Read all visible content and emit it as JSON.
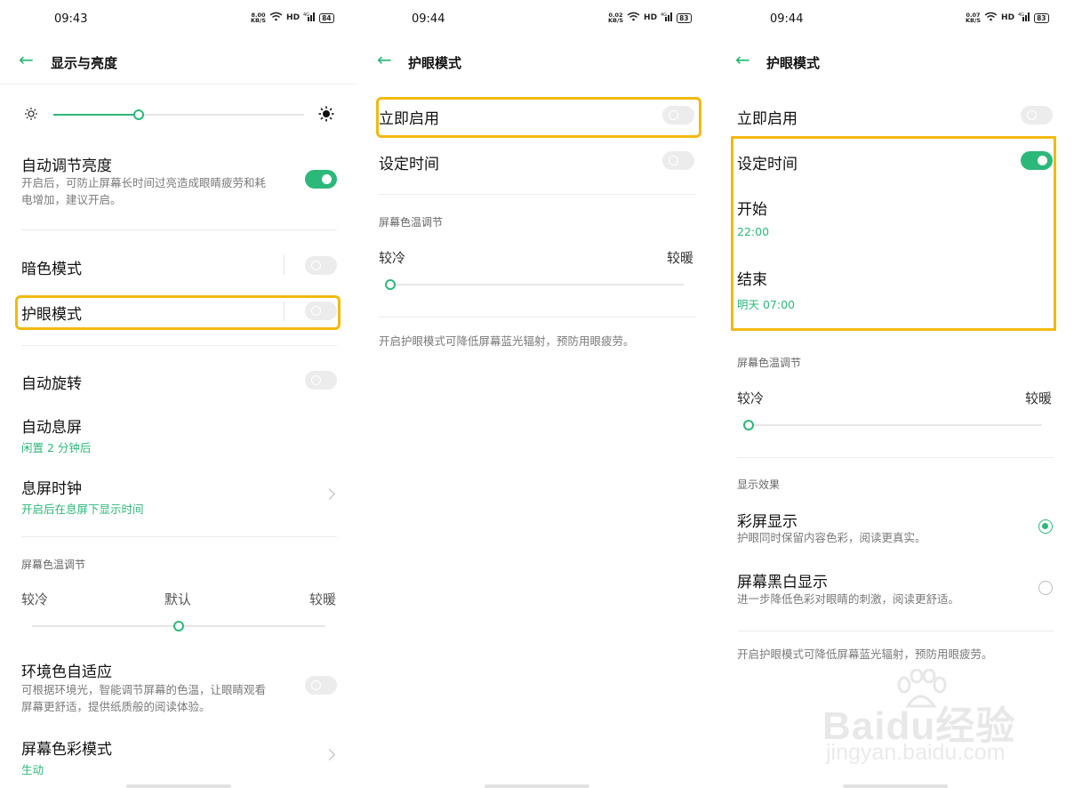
{
  "panel1": {
    "status": {
      "time": "09:43",
      "net_top": "8.00",
      "net_bottom": "KB/S",
      "hd": "HD",
      "sig": "4G",
      "battery": "84"
    },
    "title": "显示与亮度",
    "brightness": {
      "level": 0.34
    },
    "auto_brightness": {
      "label": "自动调节亮度",
      "desc_line1": "开启后，可防止屏幕长时间过亮造成眼睛疲劳和耗",
      "desc_line2": "电增加，建议开启。",
      "on": true
    },
    "dark_mode": {
      "label": "暗色模式",
      "on": false
    },
    "eye_mode": {
      "label": "护眼模式",
      "on": false
    },
    "auto_rotate": {
      "label": "自动旋转",
      "on": false
    },
    "auto_sleep": {
      "label": "自动息屏",
      "value": "闲置 2 分钟后"
    },
    "sleep_clock": {
      "label": "息屏时钟",
      "value": "开启后在息屏下显示时间"
    },
    "color_temp": {
      "section": "屏幕色温调节",
      "cool": "较冷",
      "default": "默认",
      "warm": "较暖",
      "level": 0.5
    },
    "ambient": {
      "label": "环境色自适应",
      "desc_line1": "可根据环境光，智能调节屏幕的色温，让眼睛观看",
      "desc_line2": "屏幕更舒适，提供纸质般的阅读体验。",
      "on": false
    },
    "color_mode": {
      "label": "屏幕色彩模式",
      "value": "生动"
    }
  },
  "panel2": {
    "status": {
      "time": "09:44",
      "net_top": "0.02",
      "net_bottom": "KB/S",
      "hd": "HD",
      "sig": "4G",
      "battery": "83"
    },
    "title": "护眼模式",
    "enable_now": {
      "label": "立即启用",
      "on": false
    },
    "schedule": {
      "label": "设定时间",
      "on": false
    },
    "color_temp": {
      "section": "屏幕色温调节",
      "cool": "较冷",
      "warm": "较暖",
      "level": 0.0
    },
    "footer": "开启护眼模式可降低屏幕蓝光辐射，预防用眼疲劳。"
  },
  "panel3": {
    "status": {
      "time": "09:44",
      "net_top": "0.07",
      "net_bottom": "KB/S",
      "hd": "HD",
      "sig": "4G",
      "battery": "83"
    },
    "title": "护眼模式",
    "enable_now": {
      "label": "立即启用",
      "on": false
    },
    "schedule": {
      "label": "设定时间",
      "on": true
    },
    "start": {
      "label": "开始",
      "value": "22:00"
    },
    "end": {
      "label": "结束",
      "value": "明天 07:00"
    },
    "color_temp": {
      "section": "屏幕色温调节",
      "cool": "较冷",
      "warm": "较暖",
      "level": 0.0
    },
    "display_effect": {
      "section": "显示效果",
      "color": {
        "label": "彩屏显示",
        "desc": "护眼同时保留内容色彩，阅读更真实。",
        "selected": true
      },
      "mono": {
        "label": "屏幕黑白显示",
        "desc": "进一步降低色彩对眼睛的刺激，阅读更舒适。",
        "selected": false
      }
    },
    "footer": "开启护眼模式可降低屏幕蓝光辐射，预防用眼疲劳。"
  },
  "watermark": {
    "brand": "Baidu经验",
    "url": "jingyan.baidu.com"
  },
  "colors": {
    "accent": "#2cb879",
    "highlight": "#f2b90f"
  }
}
